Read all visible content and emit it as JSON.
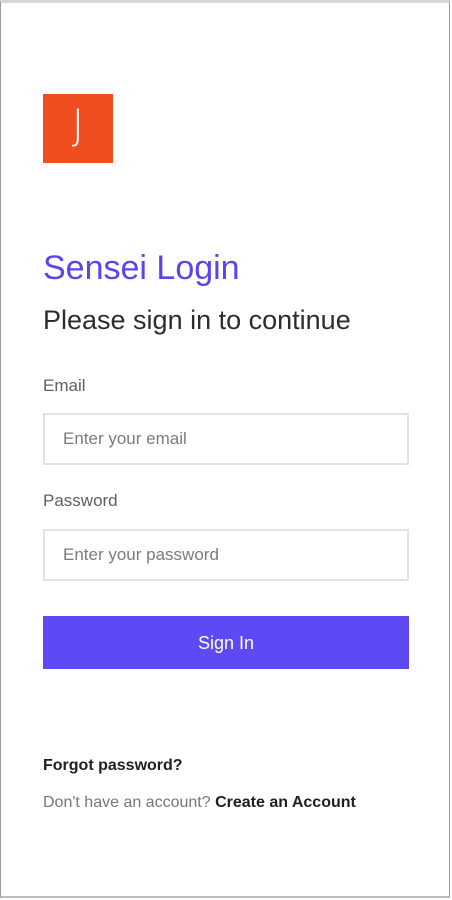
{
  "logo": {
    "letter": "J",
    "color": "#f04e1e"
  },
  "header": {
    "title": "Sensei Login",
    "subtitle": "Please sign in to continue"
  },
  "form": {
    "email_label": "Email",
    "email_placeholder": "Enter your email",
    "email_value": "",
    "password_label": "Password",
    "password_placeholder": "Enter your password",
    "password_value": "",
    "submit_label": "Sign In"
  },
  "links": {
    "forgot": "Forgot password?",
    "no_account_prompt": "Don't have an account?",
    "create_account": "Create an Account"
  },
  "colors": {
    "accent": "#5b44ee",
    "button": "#5d4af5",
    "logo": "#f04e1e"
  }
}
